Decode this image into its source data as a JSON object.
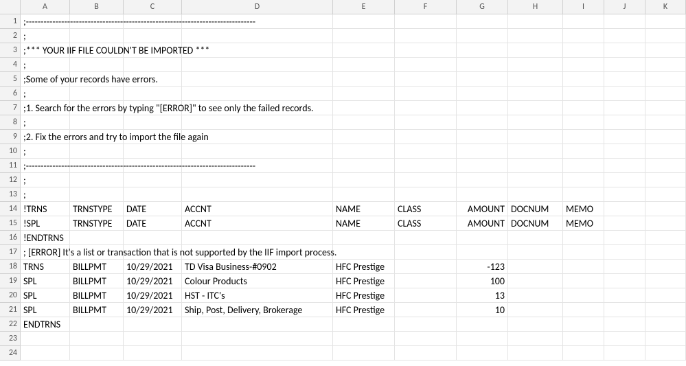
{
  "columns": [
    "A",
    "B",
    "C",
    "D",
    "E",
    "F",
    "G",
    "H",
    "I",
    "J",
    "K"
  ],
  "visible_row_count": 24,
  "cells": {
    "r1": {
      "A": ";------------------------------------------------------------------------------"
    },
    "r2": {
      "A": ";"
    },
    "r3": {
      "A": ";*** YOUR IIF FILE COULDN'T BE IMPORTED ***"
    },
    "r4": {
      "A": ";"
    },
    "r5": {
      "A": ";Some of your records have errors."
    },
    "r6": {
      "A": ";"
    },
    "r7": {
      "A": ";1. Search for the errors by typing \"[ERROR]\" to see only the failed records."
    },
    "r8": {
      "A": ";"
    },
    "r9": {
      "A": ";2. Fix the errors and try to import the file again"
    },
    "r10": {
      "A": ";"
    },
    "r11": {
      "A": ";------------------------------------------------------------------------------"
    },
    "r12": {
      "A": ";"
    },
    "r13": {
      "A": ";"
    },
    "r14": {
      "A": "!TRNS",
      "B": "TRNSTYPE",
      "C": "DATE",
      "D": "ACCNT",
      "E": "NAME",
      "F": "CLASS",
      "G": "AMOUNT",
      "H": "DOCNUM",
      "I": "MEMO"
    },
    "r15": {
      "A": "!SPL",
      "B": "TRNSTYPE",
      "C": "DATE",
      "D": "ACCNT",
      "E": "NAME",
      "F": "CLASS",
      "G": "AMOUNT",
      "H": "DOCNUM",
      "I": "MEMO"
    },
    "r16": {
      "A": "!ENDTRNS"
    },
    "r17": {
      "A": "; [ERROR] It's a list or transaction that is not supported by the IIF import process."
    },
    "r18": {
      "A": "TRNS",
      "B": "BILLPMT",
      "C": "10/29/2021",
      "D": "TD Visa Business-#0902",
      "E": "HFC Prestige",
      "G": "-123"
    },
    "r19": {
      "A": "SPL",
      "B": "BILLPMT",
      "C": "10/29/2021",
      "D": "Colour Products",
      "E": "HFC Prestige",
      "G": "100"
    },
    "r20": {
      "A": "SPL",
      "B": "BILLPMT",
      "C": "10/29/2021",
      "D": "HST - ITC's",
      "E": "HFC Prestige",
      "G": "13"
    },
    "r21": {
      "A": "SPL",
      "B": "BILLPMT",
      "C": "10/29/2021",
      "D": "Ship, Post, Delivery, Brokerage",
      "E": "HFC Prestige",
      "G": "10"
    },
    "r22": {
      "A": "ENDTRNS"
    }
  },
  "numeric_columns": [
    "G"
  ],
  "overflow_rows": [
    1,
    3,
    5,
    7,
    9,
    11,
    16,
    17,
    22
  ]
}
